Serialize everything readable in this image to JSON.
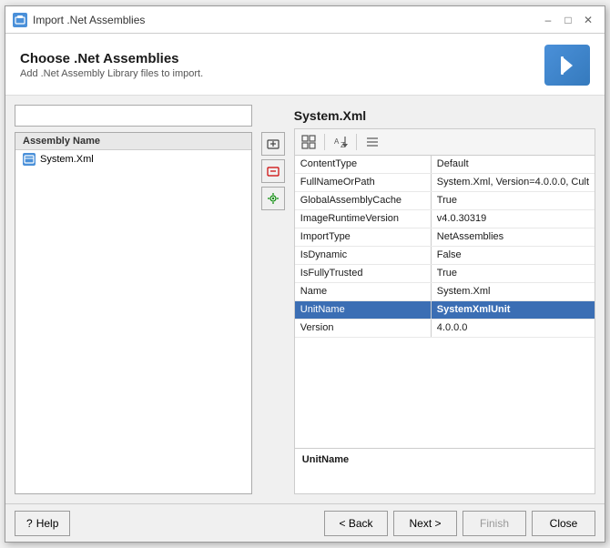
{
  "window": {
    "title": "Import .Net Assemblies",
    "minimize_label": "–",
    "maximize_label": "□",
    "close_label": "✕"
  },
  "header": {
    "title": "Choose .Net Assemblies",
    "subtitle": "Add .Net Assembly Library files to import.",
    "icon_symbol": "◄"
  },
  "left_panel": {
    "search_placeholder": "",
    "list_header": "Assembly Name",
    "items": [
      {
        "name": "System.Xml",
        "icon": "S"
      }
    ]
  },
  "right_panel": {
    "title": "System.Xml",
    "toolbar_buttons": [
      {
        "icon": "⊞",
        "name": "categorized-icon"
      },
      {
        "icon": "↕",
        "name": "sort-icon"
      },
      {
        "icon": "≡",
        "name": "list-icon"
      }
    ],
    "properties": [
      {
        "name": "ContentType",
        "value": "Default",
        "selected": false,
        "bold": false
      },
      {
        "name": "FullNameOrPath",
        "value": "System.Xml, Version=4.0.0.0, Cult",
        "selected": false,
        "bold": false
      },
      {
        "name": "GlobalAssemblyCache",
        "value": "True",
        "selected": false,
        "bold": false
      },
      {
        "name": "ImageRuntimeVersion",
        "value": "v4.0.30319",
        "selected": false,
        "bold": false
      },
      {
        "name": "ImportType",
        "value": "NetAssemblies",
        "selected": false,
        "bold": false
      },
      {
        "name": "IsDynamic",
        "value": "False",
        "selected": false,
        "bold": false
      },
      {
        "name": "IsFullyTrusted",
        "value": "True",
        "selected": false,
        "bold": false
      },
      {
        "name": "Name",
        "value": "System.Xml",
        "selected": false,
        "bold": false
      },
      {
        "name": "UnitName",
        "value": "SystemXmlUnit",
        "selected": true,
        "bold": true
      },
      {
        "name": "Version",
        "value": "4.0.0.0",
        "selected": false,
        "bold": false
      }
    ],
    "description_title": "UnitName"
  },
  "footer": {
    "help_label": "Help",
    "back_label": "< Back",
    "next_label": "Next >",
    "finish_label": "Finish",
    "close_label": "Close"
  },
  "side_buttons": {
    "add_label": "⊞",
    "remove_label": "✕",
    "config_label": "⚙"
  }
}
